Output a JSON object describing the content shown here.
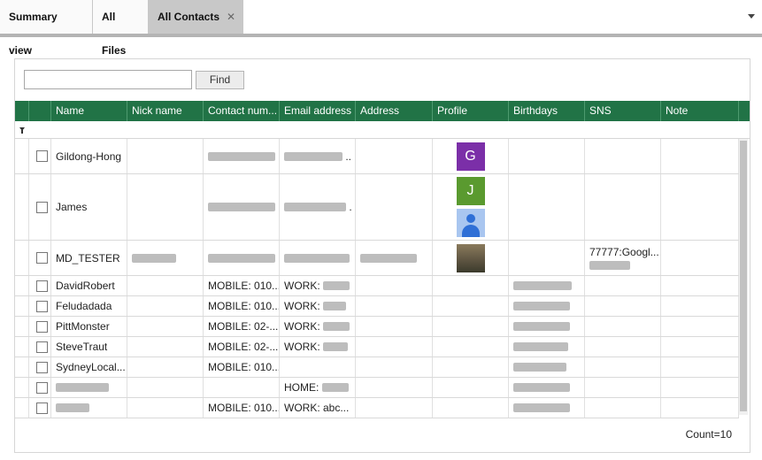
{
  "tabs": [
    {
      "label": "Summary view"
    },
    {
      "label": "All Files"
    },
    {
      "label": "All Contacts",
      "close": "✕"
    }
  ],
  "search": {
    "placeholder": "",
    "value": "",
    "find_label": "Find"
  },
  "grid": {
    "columns": [
      "Name",
      "Nick name",
      "Contact num...",
      "Email address",
      "Address",
      "Profile",
      "Birthdays",
      "SNS",
      "Note"
    ],
    "rows": [
      {
        "name": "Gildong-Hong",
        "contact": "",
        "email": "",
        "profile": [
          "G"
        ]
      },
      {
        "name": "James",
        "contact": "",
        "email": "",
        "profile": [
          "J",
          "person"
        ]
      },
      {
        "name": "MD_TESTER",
        "contact": "",
        "email": "",
        "profile": [
          "photo"
        ],
        "sns": "77777:Googl..."
      },
      {
        "name": "DavidRobert",
        "contact": "MOBILE: 010...",
        "email": "WORK:"
      },
      {
        "name": "Feludadada",
        "contact": "MOBILE: 010...",
        "email": "WORK:"
      },
      {
        "name": "PittMonster",
        "contact": "MOBILE: 02-...",
        "email": "WORK:"
      },
      {
        "name": "SteveTraut",
        "contact": "MOBILE: 02-...",
        "email": "WORK:"
      },
      {
        "name": "SydneyLocal...",
        "contact": "MOBILE: 010...",
        "email": ""
      },
      {
        "name": "",
        "contact": "",
        "email": "HOME:"
      },
      {
        "name": "",
        "contact": "MOBILE: 010...",
        "email": "WORK: abc..."
      }
    ]
  },
  "colors": {
    "header": "#217346",
    "avatar_g": "#7b2fa8",
    "avatar_j": "#5a9a2f"
  },
  "footer": {
    "count": "Count=10"
  }
}
